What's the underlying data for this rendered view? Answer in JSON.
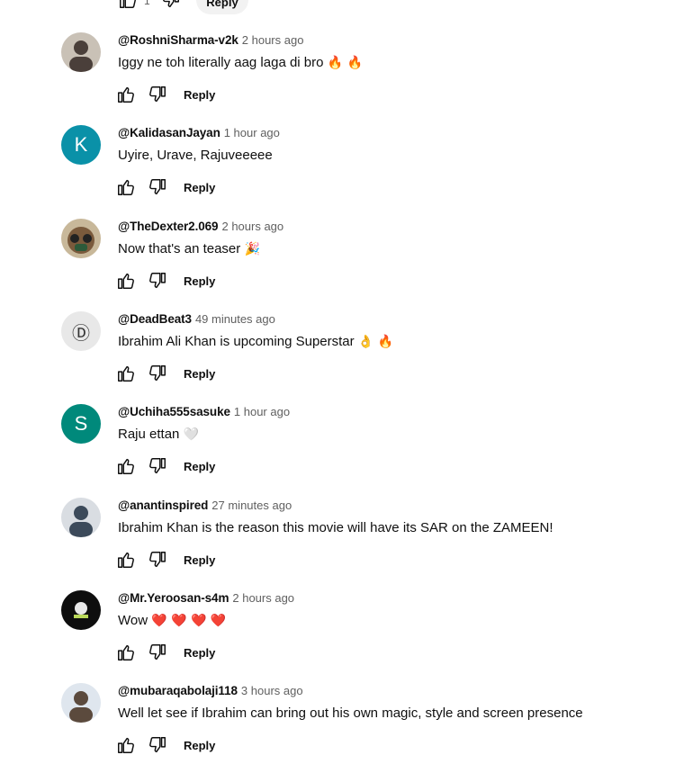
{
  "top": {
    "like_count": "1",
    "reply_label": "Reply"
  },
  "reply_label": "Reply",
  "comments": [
    {
      "author": "@RoshniSharma-v2k",
      "time": "2 hours ago",
      "text": "Iggy ne toh literally aag laga di bro",
      "emoji": "🔥 🔥",
      "avatar": {
        "type": "photo",
        "colors": [
          "#4a3f3a",
          "#c9c1b6"
        ]
      }
    },
    {
      "author": "@KalidasanJayan",
      "time": "1 hour ago",
      "text": "Uyire, Urave, Rajuveeeee",
      "emoji": "",
      "avatar": {
        "type": "letter",
        "letter": "K",
        "bg": "#0a91a8"
      }
    },
    {
      "author": "@TheDexter2.069",
      "time": "2 hours ago",
      "text": "Now that's an teaser",
      "emoji": "🎉",
      "avatar": {
        "type": "mask",
        "colors": [
          "#7a5a3c",
          "#2d5a3a"
        ]
      }
    },
    {
      "author": "@DeadBeat3",
      "time": "49 minutes ago",
      "text": "Ibrahim Ali Khan is upcoming Superstar",
      "emoji": "👌 🔥",
      "avatar": {
        "type": "logo",
        "glyph": "Ⓓ",
        "bg": "#e8e8e8"
      }
    },
    {
      "author": "@Uchiha555sasuke",
      "time": "1 hour ago",
      "text": "Raju ettan",
      "emoji": "🤍",
      "avatar": {
        "type": "letter",
        "letter": "S",
        "bg": "#00897b"
      }
    },
    {
      "author": "@anantinspired",
      "time": "27 minutes ago",
      "text": "Ibrahim Khan is the reason this movie will have its SAR on the ZAMEEN!",
      "emoji": "",
      "avatar": {
        "type": "photo",
        "colors": [
          "#3c4a5a",
          "#d9dde2"
        ]
      }
    },
    {
      "author": "@Mr.Yeroosan-s4m",
      "time": "2 hours ago",
      "text": "Wow",
      "emoji": "❤️ ❤️ ❤️ ❤️",
      "avatar": {
        "type": "dark",
        "colors": [
          "#0e0e0e",
          "#b9d85a"
        ]
      }
    },
    {
      "author": "@mubaraqabolaji118",
      "time": "3 hours ago",
      "text": "Well let see if Ibrahim can bring out his own magic, style and screen presence",
      "emoji": "",
      "avatar": {
        "type": "photo",
        "colors": [
          "#5b4a3d",
          "#dfe6ee"
        ]
      }
    }
  ]
}
